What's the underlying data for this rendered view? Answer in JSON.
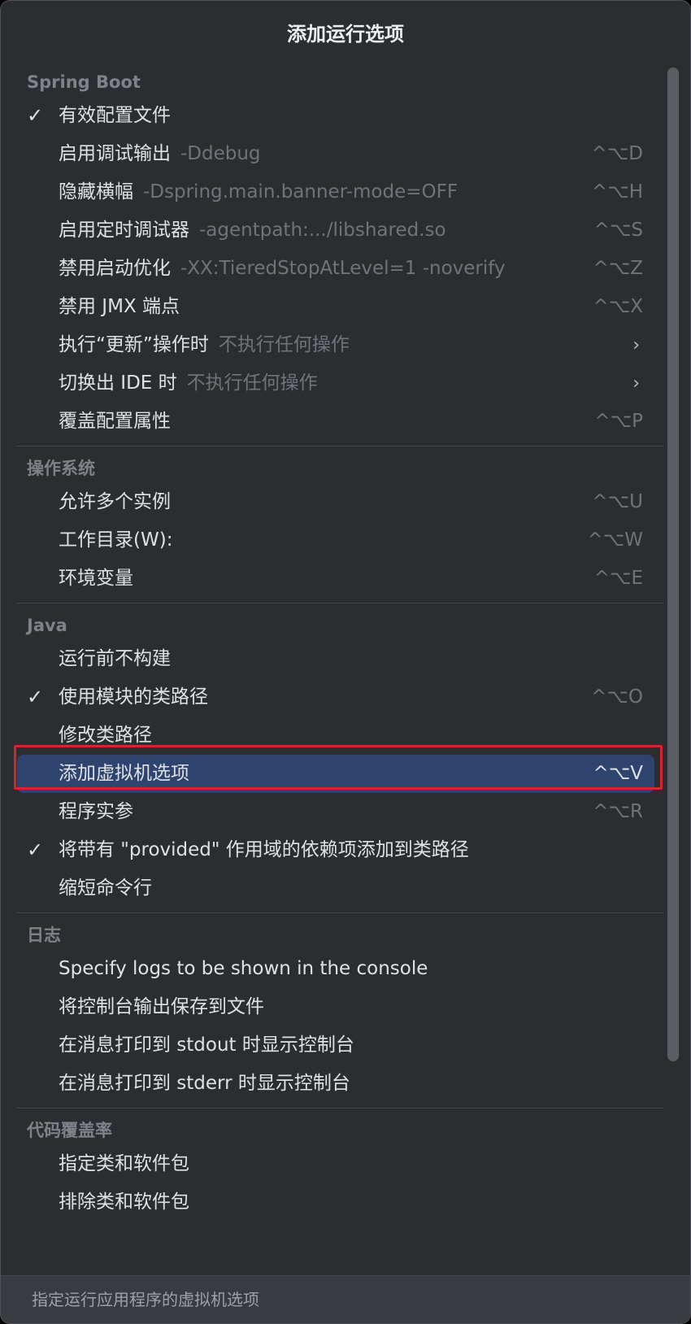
{
  "popup": {
    "title": "添加运行选项",
    "footer_text": "指定运行应用程序的虚拟机选项",
    "selected_item": "添加虚拟机选项"
  },
  "sections": [
    {
      "header": "Spring Boot",
      "items": [
        {
          "checked": true,
          "label": "有效配置文件",
          "hint": "",
          "shortcut": ""
        },
        {
          "checked": false,
          "label": "启用调试输出",
          "hint": "-Ddebug",
          "shortcut": "^⌥D"
        },
        {
          "checked": false,
          "label": "隐藏横幅",
          "hint": "-Dspring.main.banner-mode=OFF",
          "shortcut": "^⌥H"
        },
        {
          "checked": false,
          "label": "启用定时调试器",
          "hint": "-agentpath:.../libshared.so",
          "shortcut": "^⌥S"
        },
        {
          "checked": false,
          "label": "禁用启动优化",
          "hint": "-XX:TieredStopAtLevel=1 -noverify",
          "shortcut": "^⌥Z"
        },
        {
          "checked": false,
          "label": "禁用 JMX 端点",
          "hint": "",
          "shortcut": "^⌥X"
        },
        {
          "checked": false,
          "label": "执行“更新”操作时",
          "hint": "不执行任何操作",
          "shortcut": "",
          "submenu": true
        },
        {
          "checked": false,
          "label": "切换出 IDE 时",
          "hint": "不执行任何操作",
          "shortcut": "",
          "submenu": true
        },
        {
          "checked": false,
          "label": "覆盖配置属性",
          "hint": "",
          "shortcut": "^⌥P"
        }
      ]
    },
    {
      "header": "操作系统",
      "items": [
        {
          "checked": false,
          "label": "允许多个实例",
          "hint": "",
          "shortcut": "^⌥U"
        },
        {
          "checked": false,
          "label": "工作目录(W):",
          "hint": "",
          "shortcut": "^⌥W"
        },
        {
          "checked": false,
          "label": "环境变量",
          "hint": "",
          "shortcut": "^⌥E"
        }
      ]
    },
    {
      "header": "Java",
      "items": [
        {
          "checked": false,
          "label": "运行前不构建",
          "hint": "",
          "shortcut": ""
        },
        {
          "checked": true,
          "label": "使用模块的类路径",
          "hint": "",
          "shortcut": "^⌥O"
        },
        {
          "checked": false,
          "label": "修改类路径",
          "hint": "",
          "shortcut": ""
        },
        {
          "checked": false,
          "label": "添加虚拟机选项",
          "hint": "",
          "shortcut": "^⌥V",
          "selected": true
        },
        {
          "checked": false,
          "label": "程序实参",
          "hint": "",
          "shortcut": "^⌥R"
        },
        {
          "checked": true,
          "label": "将带有 \"provided\" 作用域的依赖项添加到类路径",
          "hint": "",
          "shortcut": ""
        },
        {
          "checked": false,
          "label": "缩短命令行",
          "hint": "",
          "shortcut": ""
        }
      ]
    },
    {
      "header": "日志",
      "items": [
        {
          "checked": false,
          "label": "Specify logs to be shown in the console",
          "hint": "",
          "shortcut": ""
        },
        {
          "checked": false,
          "label": "将控制台输出保存到文件",
          "hint": "",
          "shortcut": ""
        },
        {
          "checked": false,
          "label": "在消息打印到 stdout 时显示控制台",
          "hint": "",
          "shortcut": ""
        },
        {
          "checked": false,
          "label": "在消息打印到 stderr 时显示控制台",
          "hint": "",
          "shortcut": ""
        }
      ]
    },
    {
      "header": "代码覆盖率",
      "items": [
        {
          "checked": false,
          "label": "指定类和软件包",
          "hint": "",
          "shortcut": ""
        },
        {
          "checked": false,
          "label": "排除类和软件包",
          "hint": "",
          "shortcut": ""
        }
      ]
    }
  ],
  "icons": {
    "check": "checkmark-icon",
    "submenu": "chevron-right-icon"
  },
  "colors": {
    "background": "#2b2d30",
    "selection": "#2e436e",
    "annotation_frame": "#d6262d",
    "hint_text": "#6f737a",
    "section_header": "#7e828a"
  }
}
